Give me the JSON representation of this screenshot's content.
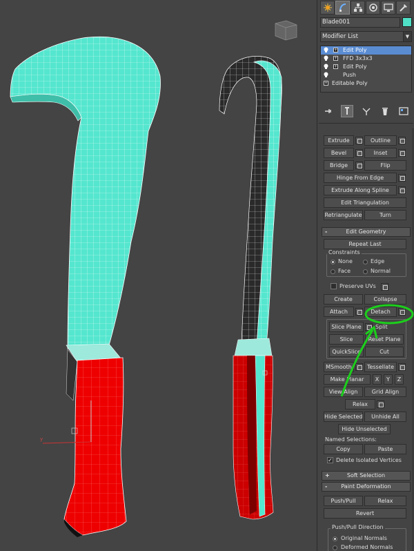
{
  "viewport": {
    "axis_y_label": "y"
  },
  "panel": {
    "tabs": [
      "create-icon",
      "modify-icon",
      "hierarchy-icon",
      "motion-icon",
      "display-icon",
      "utilities-icon"
    ],
    "object_name": "Blade001",
    "object_color": "#4fe0c6",
    "modifier_list_label": "Modifier List",
    "stack": [
      {
        "label": "Edit Poly",
        "selected": true
      },
      {
        "label": "FFD 3x3x3",
        "selected": false
      },
      {
        "label": "Edit Poly",
        "selected": false
      },
      {
        "label": "Push",
        "selected": false
      },
      {
        "label": "Editable Poly",
        "selected": false
      }
    ],
    "edit_edges": {
      "extrude": "Extrude",
      "outline": "Outline",
      "bevel": "Bevel",
      "inset": "Inset",
      "bridge": "Bridge",
      "flip": "Flip",
      "hinge": "Hinge From Edge",
      "extrude_spline": "Extrude Along Spline",
      "edit_tri": "Edit Triangulation",
      "retriangulate": "Retriangulate",
      "turn": "Turn"
    },
    "edit_geometry": {
      "title": "Edit Geometry",
      "sign": "-",
      "repeat_last": "Repeat Last",
      "constraints": "Constraints",
      "none": "None",
      "edge": "Edge",
      "face": "Face",
      "normal": "Normal",
      "preserve_uvs": "Preserve UVs",
      "create": "Create",
      "collapse": "Collapse",
      "attach": "Attach",
      "detach": "Detach",
      "slice_plane": "Slice Plane",
      "split": "Split",
      "slice": "Slice",
      "reset_plane": "Reset Plane",
      "quickslice": "QuickSlice",
      "cut": "Cut",
      "msmooth": "MSmooth",
      "tessellate": "Tessellate",
      "make_planar": "Make Planar",
      "x": "X",
      "y": "Y",
      "z": "Z",
      "view_align": "View Align",
      "grid_align": "Grid Align",
      "relax": "Relax",
      "hide_selected": "Hide Selected",
      "unhide_all": "Unhide All",
      "hide_unselected": "Hide Unselected",
      "named_selections": "Named Selections:",
      "copy": "Copy",
      "paste": "Paste",
      "delete_isolated": "Delete Isolated Vertices"
    },
    "soft_selection": {
      "title": "Soft Selection",
      "sign": "+"
    },
    "paint_deformation": {
      "title": "Paint Deformation",
      "sign": "-",
      "push_pull": "Push/Pull",
      "relax": "Relax",
      "revert": "Revert",
      "direction": "Push/Pull Direction",
      "original_normals": "Original Normals",
      "deformed_normals": "Deformed Normals"
    },
    "annotation_color": "#1ccf1c"
  }
}
